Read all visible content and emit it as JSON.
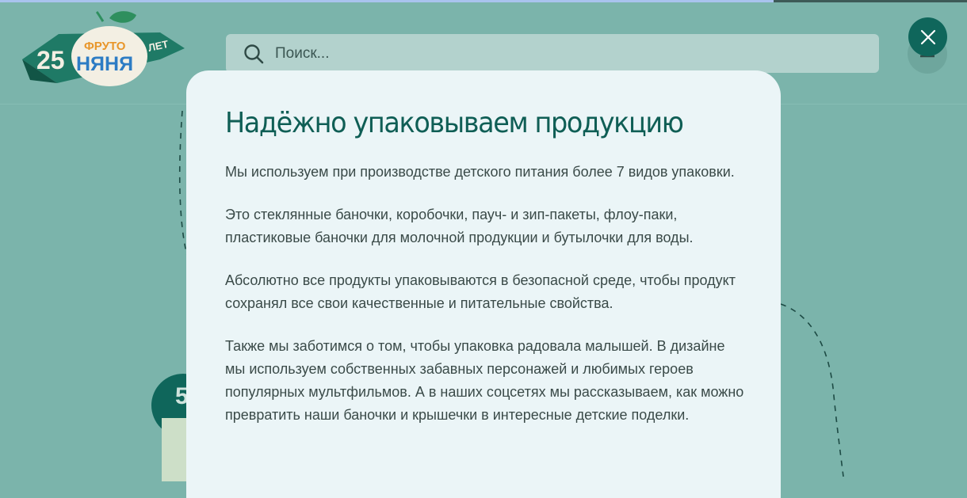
{
  "progress": {
    "fraction": 0.8
  },
  "logo": {
    "years": "25",
    "years_word": "ЛЕТ",
    "brand_top": "ФРУТО",
    "brand_bottom": "НЯНЯ"
  },
  "search": {
    "placeholder": "Поиск...",
    "value": ""
  },
  "modal": {
    "title": "Надёжно упаковываем продукцию",
    "paragraphs": [
      "Мы используем при производстве детского питания более 7 видов упаковки.",
      "Это стеклянные баночки, коробочки, пауч- и зип-пакеты, флоу-паки, пластиковые баночки для молочной продукции и бутылочки для воды.",
      "Абсолютно все продукты упаковываются в безопасной среде, чтобы продукт сохранял все свои качественные и питательные свойства.",
      "Также мы заботимся о том, чтобы упаковка радовала малышей. В дизайне мы используем собственных забавных персонажей и любимых героев популярных мультфильмов. А в наших соцсетях мы рассказываем, как можно превратить наши баночки и крышечки в интересные детские поделки."
    ]
  },
  "background": {
    "step_number": "5"
  },
  "icons": {
    "search": "search-icon",
    "close": "close-icon",
    "menu": "menu-icon"
  },
  "colors": {
    "page_bg": "#7bb4ab",
    "brand_green": "#0f665b",
    "title_green": "#0f5e55",
    "modal_bg": "#ebf5f7",
    "search_bg": "#b3d2cd"
  }
}
